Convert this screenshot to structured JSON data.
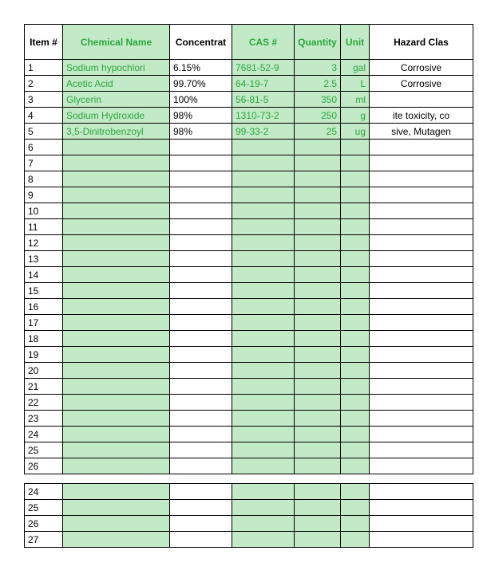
{
  "colors": {
    "highlight_bg": "#c3eac7",
    "highlight_fg": "#2aa63b"
  },
  "headers": {
    "item": "Item #",
    "chemical_name": "Chemical Name",
    "concentration": "Concentrat",
    "cas": "CAS #",
    "quantity": "Quantity",
    "unit": "Unit",
    "hazard": "Hazard Clas"
  },
  "rows": [
    {
      "item": "1",
      "name": "Sodium hypochlori",
      "conc": "6.15%",
      "cas": "7681-52-9",
      "qty": "3",
      "unit": "gal",
      "haz": "Corrosive"
    },
    {
      "item": "2",
      "name": "Acetic Acid",
      "conc": "99.70%",
      "cas": "64-19-7",
      "qty": "2.5",
      "unit": "L",
      "haz": "Corrosive"
    },
    {
      "item": "3",
      "name": "Glycerin",
      "conc": "100%",
      "cas": "56-81-5",
      "qty": "350",
      "unit": "ml",
      "haz": ""
    },
    {
      "item": "4",
      "name": "Sodium Hydroxide",
      "conc": "98%",
      "cas": "1310-73-2",
      "qty": "250",
      "unit": "g",
      "haz": "ite toxicity, co"
    },
    {
      "item": "5",
      "name": "3,5-Dinitrobenzoyl",
      "conc": "98%",
      "cas": "99-33-2",
      "qty": "25",
      "unit": "ug",
      "haz": "sive, Mutagen"
    },
    {
      "item": "6",
      "name": "",
      "conc": "",
      "cas": "",
      "qty": "",
      "unit": "",
      "haz": ""
    },
    {
      "item": "7",
      "name": "",
      "conc": "",
      "cas": "",
      "qty": "",
      "unit": "",
      "haz": ""
    },
    {
      "item": "8",
      "name": "",
      "conc": "",
      "cas": "",
      "qty": "",
      "unit": "",
      "haz": ""
    },
    {
      "item": "9",
      "name": "",
      "conc": "",
      "cas": "",
      "qty": "",
      "unit": "",
      "haz": ""
    },
    {
      "item": "10",
      "name": "",
      "conc": "",
      "cas": "",
      "qty": "",
      "unit": "",
      "haz": ""
    },
    {
      "item": "11",
      "name": "",
      "conc": "",
      "cas": "",
      "qty": "",
      "unit": "",
      "haz": ""
    },
    {
      "item": "12",
      "name": "",
      "conc": "",
      "cas": "",
      "qty": "",
      "unit": "",
      "haz": ""
    },
    {
      "item": "13",
      "name": "",
      "conc": "",
      "cas": "",
      "qty": "",
      "unit": "",
      "haz": ""
    },
    {
      "item": "14",
      "name": "",
      "conc": "",
      "cas": "",
      "qty": "",
      "unit": "",
      "haz": ""
    },
    {
      "item": "15",
      "name": "",
      "conc": "",
      "cas": "",
      "qty": "",
      "unit": "",
      "haz": ""
    },
    {
      "item": "16",
      "name": "",
      "conc": "",
      "cas": "",
      "qty": "",
      "unit": "",
      "haz": ""
    },
    {
      "item": "17",
      "name": "",
      "conc": "",
      "cas": "",
      "qty": "",
      "unit": "",
      "haz": ""
    },
    {
      "item": "18",
      "name": "",
      "conc": "",
      "cas": "",
      "qty": "",
      "unit": "",
      "haz": ""
    },
    {
      "item": "19",
      "name": "",
      "conc": "",
      "cas": "",
      "qty": "",
      "unit": "",
      "haz": ""
    },
    {
      "item": "20",
      "name": "",
      "conc": "",
      "cas": "",
      "qty": "",
      "unit": "",
      "haz": ""
    },
    {
      "item": "21",
      "name": "",
      "conc": "",
      "cas": "",
      "qty": "",
      "unit": "",
      "haz": ""
    },
    {
      "item": "22",
      "name": "",
      "conc": "",
      "cas": "",
      "qty": "",
      "unit": "",
      "haz": ""
    },
    {
      "item": "23",
      "name": "",
      "conc": "",
      "cas": "",
      "qty": "",
      "unit": "",
      "haz": ""
    },
    {
      "item": "24",
      "name": "",
      "conc": "",
      "cas": "",
      "qty": "",
      "unit": "",
      "haz": ""
    },
    {
      "item": "25",
      "name": "",
      "conc": "",
      "cas": "",
      "qty": "",
      "unit": "",
      "haz": ""
    },
    {
      "item": "26",
      "name": "",
      "conc": "",
      "cas": "",
      "qty": "",
      "unit": "",
      "haz": ""
    }
  ],
  "rows2": [
    {
      "item": "24",
      "name": "",
      "conc": "",
      "cas": "",
      "qty": "",
      "unit": "",
      "haz": ""
    },
    {
      "item": "25",
      "name": "",
      "conc": "",
      "cas": "",
      "qty": "",
      "unit": "",
      "haz": ""
    },
    {
      "item": "26",
      "name": "",
      "conc": "",
      "cas": "",
      "qty": "",
      "unit": "",
      "haz": ""
    },
    {
      "item": "27",
      "name": "",
      "conc": "",
      "cas": "",
      "qty": "",
      "unit": "",
      "haz": ""
    }
  ]
}
